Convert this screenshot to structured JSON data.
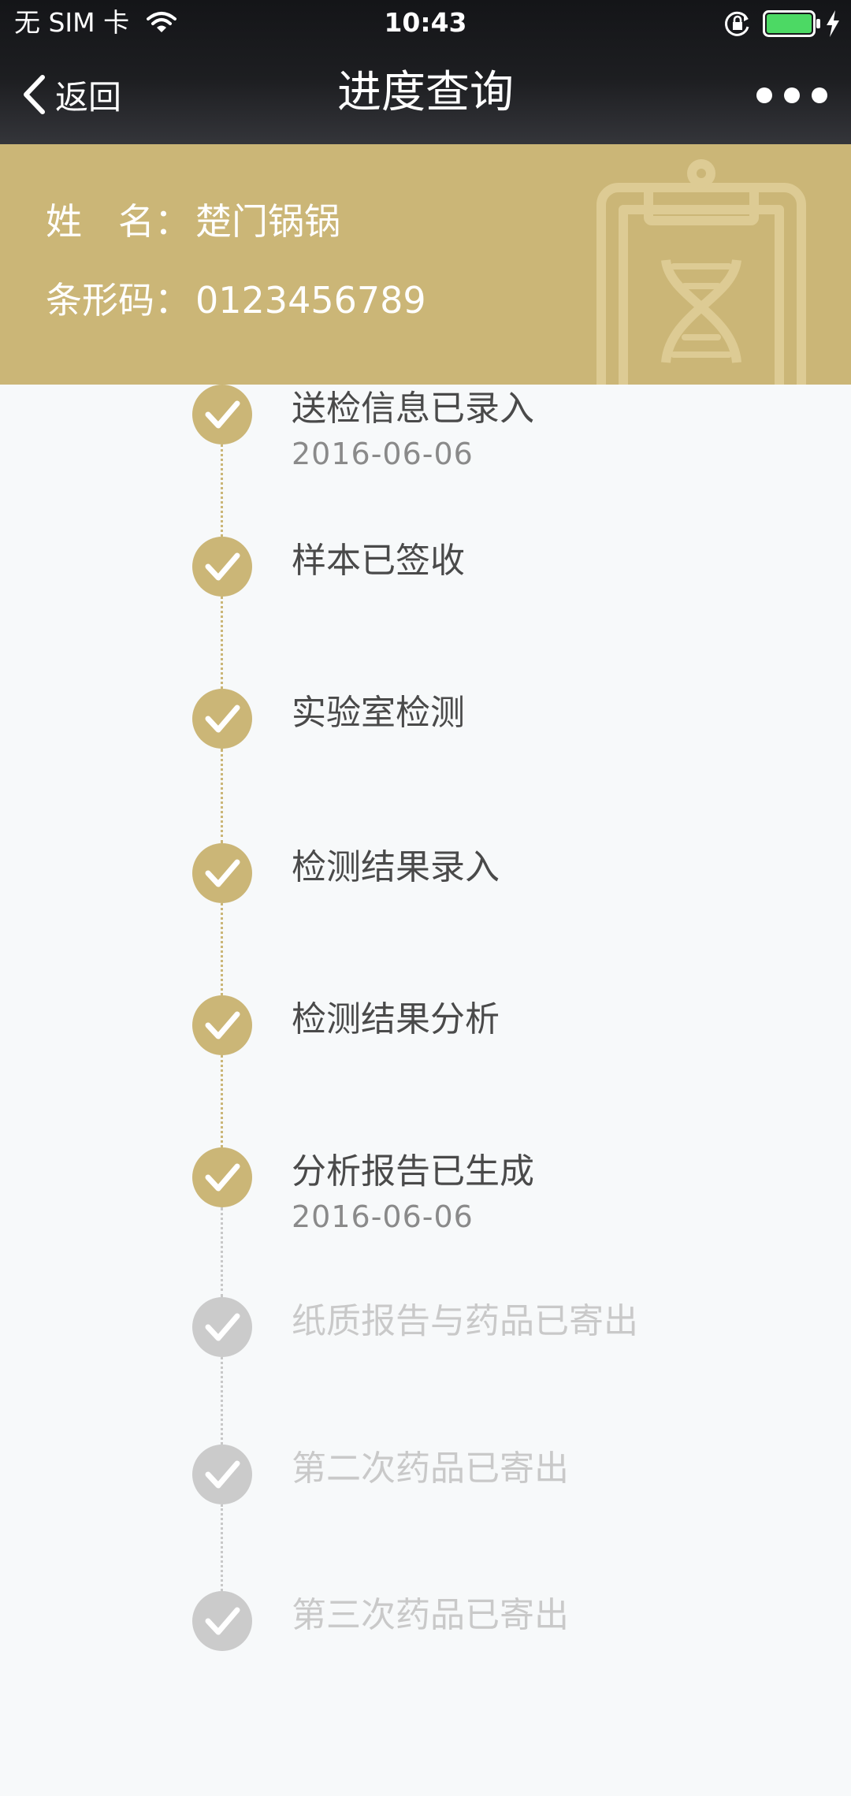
{
  "status_bar": {
    "carrier": "无 SIM 卡",
    "time": "10:43",
    "battery_color": "#4cd964"
  },
  "nav": {
    "back_label": "返回",
    "title": "进度查询",
    "more_icon": "more-dots-icon"
  },
  "patient": {
    "name_label": "姓　名：",
    "name_value": "楚门锅锅",
    "barcode_label": "条形码：",
    "barcode_value": "0123456789"
  },
  "colors": {
    "accent": "#cbb677",
    "done_text": "#4a4a4a",
    "pending": "#cbcbcb"
  },
  "steps": [
    {
      "title": "送检信息已录入",
      "date": "2016-06-06",
      "status": "done"
    },
    {
      "title": "样本已签收",
      "date": "",
      "status": "done"
    },
    {
      "title": "实验室检测",
      "date": "",
      "status": "done"
    },
    {
      "title": "检测结果录入",
      "date": "",
      "status": "done"
    },
    {
      "title": "检测结果分析",
      "date": "",
      "status": "done"
    },
    {
      "title": "分析报告已生成",
      "date": "2016-06-06",
      "status": "done"
    },
    {
      "title": "纸质报告与药品已寄出",
      "date": "",
      "status": "pending"
    },
    {
      "title": "第二次药品已寄出",
      "date": "",
      "status": "pending"
    },
    {
      "title": "第三次药品已寄出",
      "date": "",
      "status": "pending"
    }
  ]
}
